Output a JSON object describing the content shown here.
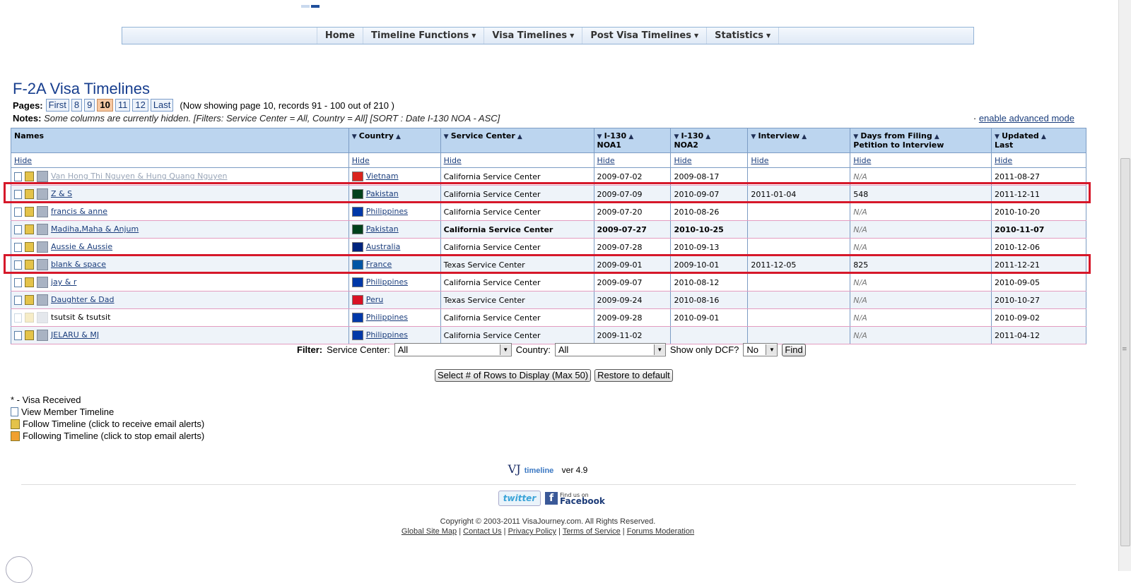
{
  "nav": {
    "items": [
      {
        "label": "Home",
        "dropdown": false
      },
      {
        "label": "Timeline Functions",
        "dropdown": true
      },
      {
        "label": "Visa Timelines",
        "dropdown": true
      },
      {
        "label": "Post Visa Timelines",
        "dropdown": true
      },
      {
        "label": "Statistics",
        "dropdown": true
      }
    ]
  },
  "page": {
    "title": "F-2A Visa Timelines",
    "pages_label": "Pages:",
    "pages": [
      "First",
      "8",
      "9",
      "10",
      "11",
      "12",
      "Last"
    ],
    "current_page": "10",
    "showing": "(Now showing page 10, records 91 - 100 out of 210 )",
    "notes_label": "Notes:",
    "notes_text": "Some columns are currently hidden. [Filters: Service Center = All, Country = All] [SORT : Date I-130 NOA - ASC]",
    "advanced_prefix": "·",
    "advanced_link": "enable advanced mode"
  },
  "table": {
    "headers": [
      "Names",
      "Country",
      "Service Center",
      "I-130 NOA1",
      "I-130 NOA2",
      "Interview",
      "Days from Filing Petition to Interview",
      "Updated Last"
    ],
    "header_lines": [
      [
        "Names"
      ],
      [
        "Country"
      ],
      [
        "Service Center"
      ],
      [
        "I-130",
        "NOA1"
      ],
      [
        "I-130",
        "NOA2"
      ],
      [
        "Interview"
      ],
      [
        "Days from Filing",
        "Petition to Interview"
      ],
      [
        "Updated",
        "Last"
      ]
    ],
    "hide_label": "Hide",
    "rows": [
      {
        "name": "Van Hong Thi Nguyen & Hung Quang Nguyen",
        "country": "Vietnam",
        "flag_color": "#da251d",
        "center": "California Service Center",
        "noa1": "2009-07-02",
        "noa2": "2009-08-17",
        "interview": "",
        "days": "N/A",
        "updated": "2011-08-27",
        "dim": true
      },
      {
        "name": "Z & S",
        "country": "Pakistan",
        "flag_color": "#01411c",
        "center": "California Service Center",
        "noa1": "2009-07-09",
        "noa2": "2010-09-07",
        "interview": "2011-01-04",
        "days": "548",
        "updated": "2011-12-11",
        "highlight": true
      },
      {
        "name": "francis & anne",
        "country": "Philippines",
        "flag_color": "#0038a8",
        "center": "California Service Center",
        "noa1": "2009-07-20",
        "noa2": "2010-08-26",
        "interview": "",
        "days": "N/A",
        "updated": "2010-10-20"
      },
      {
        "name": "Madiha,Maha & Anjum",
        "country": "Pakistan",
        "flag_color": "#01411c",
        "center": "California Service Center",
        "noa1": "2009-07-27",
        "noa2": "2010-10-25",
        "interview": "",
        "days": "N/A",
        "updated": "2010-11-07",
        "bold": true
      },
      {
        "name": "Aussie & Aussie",
        "country": "Australia",
        "flag_color": "#00247d",
        "center": "California Service Center",
        "noa1": "2009-07-28",
        "noa2": "2010-09-13",
        "interview": "",
        "days": "N/A",
        "updated": "2010-12-06"
      },
      {
        "name": "blank & space",
        "country": "France",
        "flag_color": "#0055a4",
        "center": "Texas Service Center",
        "noa1": "2009-09-01",
        "noa2": "2009-10-01",
        "interview": "2011-12-05",
        "days": "825",
        "updated": "2011-12-21",
        "highlight": true
      },
      {
        "name": "jay & r",
        "country": "Philippines",
        "flag_color": "#0038a8",
        "center": "California Service Center",
        "noa1": "2009-09-07",
        "noa2": "2010-08-12",
        "interview": "",
        "days": "N/A",
        "updated": "2010-09-05"
      },
      {
        "name": "Daughter & Dad",
        "country": "Peru",
        "flag_color": "#d91023",
        "center": "Texas Service Center",
        "noa1": "2009-09-24",
        "noa2": "2010-08-16",
        "interview": "",
        "days": "N/A",
        "updated": "2010-10-27"
      },
      {
        "name": "tsutsit & tsutsit",
        "country": "Philippines",
        "flag_color": "#0038a8",
        "center": "California Service Center",
        "noa1": "2009-09-28",
        "noa2": "2010-09-01",
        "interview": "",
        "days": "N/A",
        "updated": "2010-09-02",
        "nolink": true
      },
      {
        "name": "JELARU & MJ",
        "country": "Philippines",
        "flag_color": "#0038a8",
        "center": "California Service Center",
        "noa1": "2009-11-02",
        "noa2": "",
        "interview": "",
        "days": "N/A",
        "updated": "2011-04-12"
      }
    ]
  },
  "filter": {
    "label": "Filter:",
    "service_center_label": "Service Center:",
    "service_center_value": "All",
    "country_label": "Country:",
    "country_value": "All",
    "dcf_label": "Show only DCF?",
    "dcf_value": "No",
    "find_label": "Find"
  },
  "buttons": {
    "rows_label": "Select # of Rows to Display (Max 50)",
    "restore_label": "Restore to default"
  },
  "legend": {
    "visa_received": "* - Visa Received",
    "view_member": "View Member Timeline",
    "follow": "Follow Timeline (click to receive email alerts)",
    "following": "Following Timeline (click to stop email alerts)"
  },
  "footer": {
    "logo_vj": "VJ",
    "logo_word": "timeline",
    "version": "ver 4.9",
    "twitter": "twitter",
    "fb_top": "Find us on",
    "fb_bottom": "Facebook",
    "copyright": "Copyright © 2003-2011 VisaJourney.com. All Rights Reserved.",
    "links": [
      "Global Site Map",
      "Contact Us",
      "Privacy Policy",
      "Terms of Service",
      "Forums Moderation"
    ]
  }
}
